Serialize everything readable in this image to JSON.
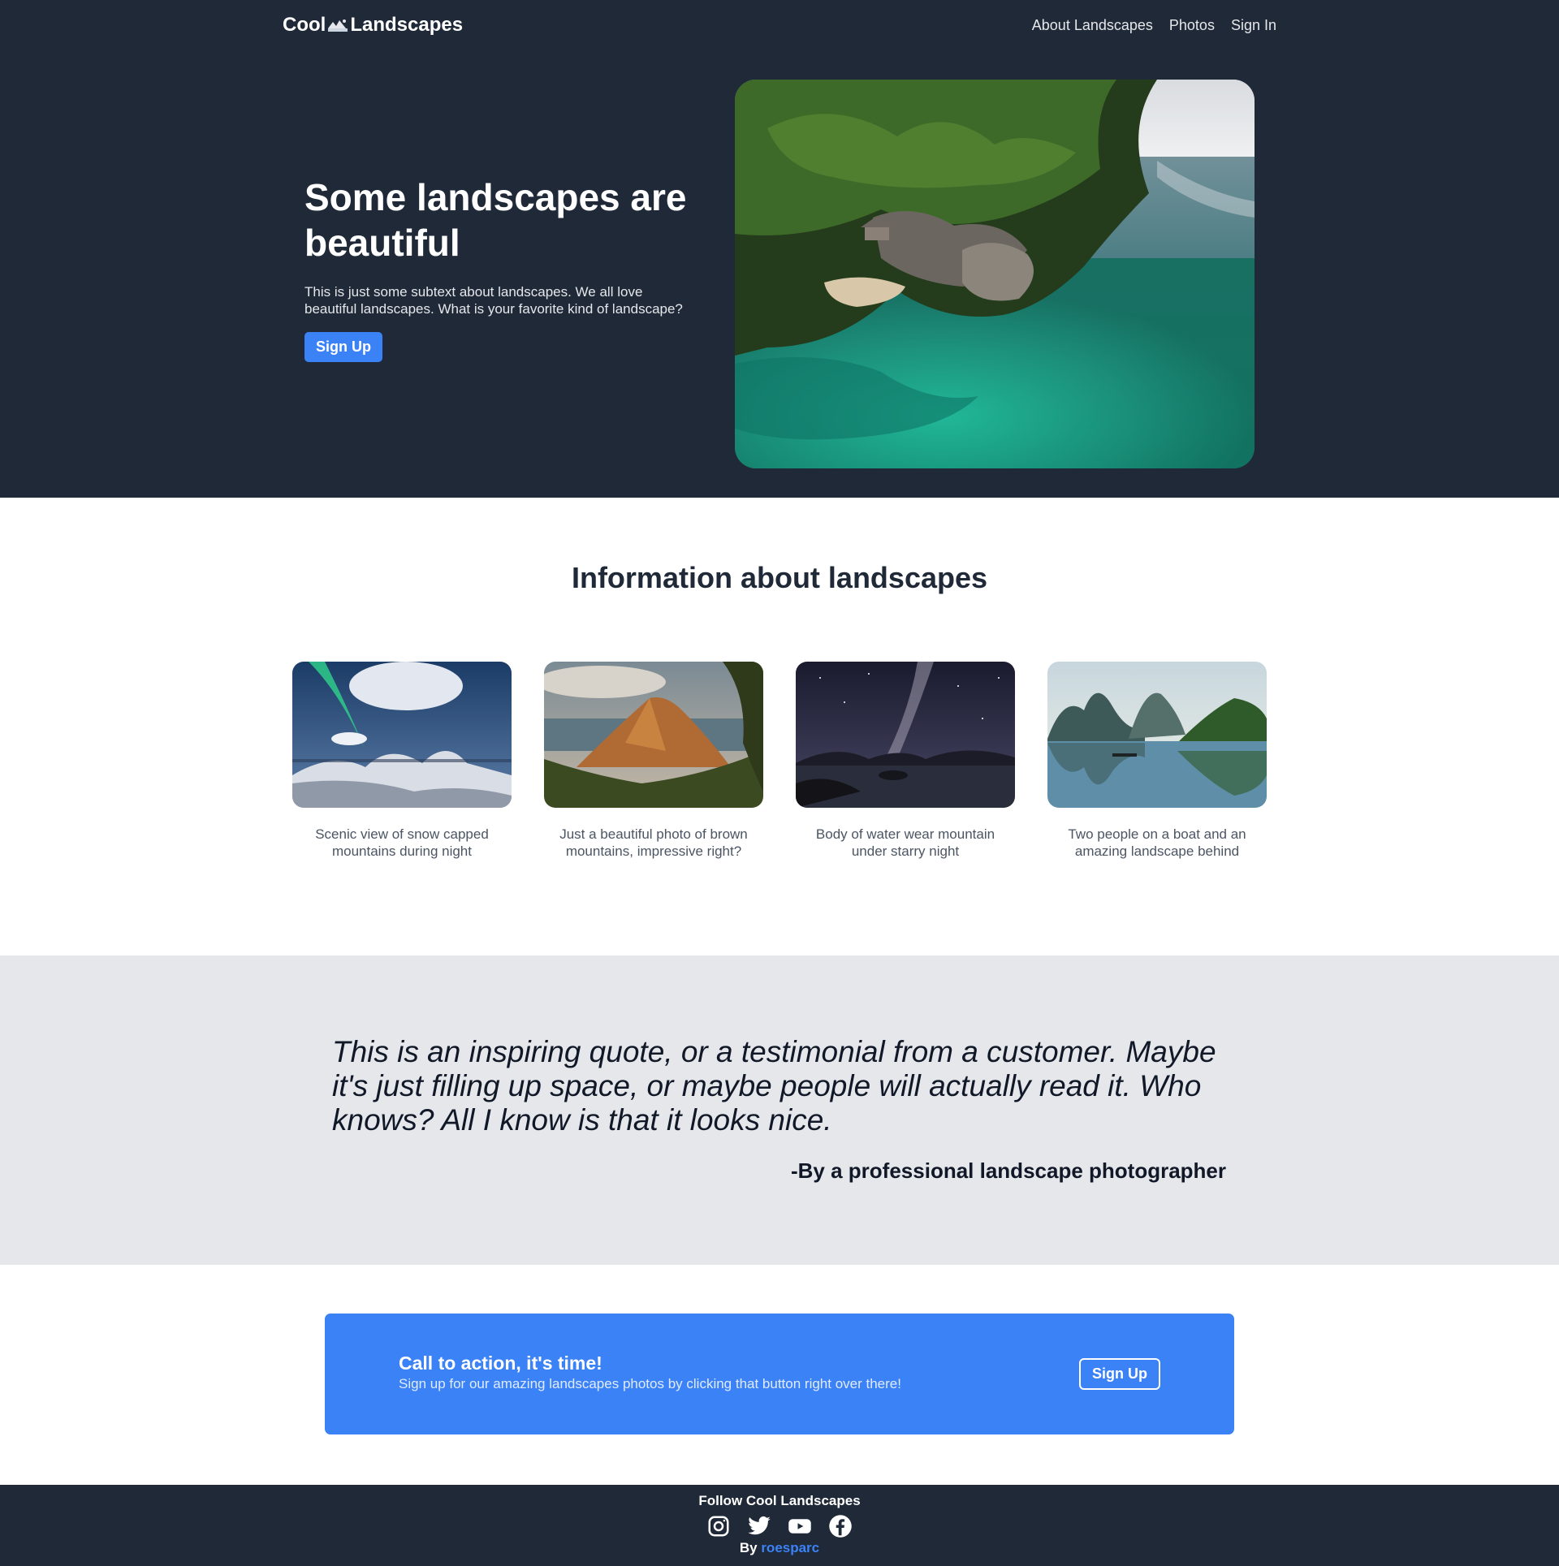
{
  "nav": {
    "brand_left": "Cool",
    "brand_right": "Landscapes",
    "links": [
      "About Landscapes",
      "Photos",
      "Sign In"
    ]
  },
  "hero": {
    "title": "Some landscapes are beautiful",
    "subtitle": "This is just some subtext about landscapes. We all love beautiful landscapes. What is your favorite kind of landscape?",
    "button": "Sign Up"
  },
  "info": {
    "title": "Information about landscapes",
    "cards": [
      {
        "caption": "Scenic view of snow capped mountains during night"
      },
      {
        "caption": "Just a beautiful photo of brown mountains, impressive right?"
      },
      {
        "caption": "Body of water wear mountain under starry night"
      },
      {
        "caption": "Two people on a boat and an amazing landscape behind"
      }
    ]
  },
  "quote": {
    "text": "This is an inspiring quote, or a testimonial from a customer. Maybe it's just filling up space, or maybe people will actually read it. Who knows? All I know is that it looks nice.",
    "author": "-By a professional landscape photographer"
  },
  "cta": {
    "title": "Call to action, it's time!",
    "subtitle": "Sign up for our amazing landscapes photos by clicking that button right over there!",
    "button": "Sign Up"
  },
  "footer": {
    "title": "Follow Cool Landscapes",
    "socials": [
      "instagram-icon",
      "twitter-icon",
      "youtube-icon",
      "facebook-icon"
    ],
    "by_prefix": "By ",
    "by_link": "roesparc"
  },
  "colors": {
    "dark": "#1f2937",
    "accent": "#3b82f6",
    "gray_band": "#e5e7eb"
  }
}
